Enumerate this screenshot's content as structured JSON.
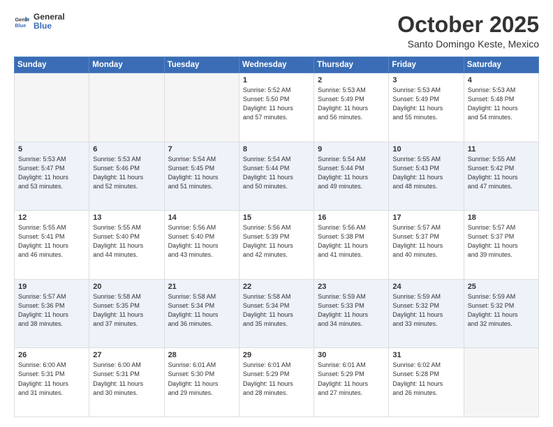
{
  "logo": {
    "text_general": "General",
    "text_blue": "Blue"
  },
  "title": "October 2025",
  "location": "Santo Domingo Keste, Mexico",
  "days_of_week": [
    "Sunday",
    "Monday",
    "Tuesday",
    "Wednesday",
    "Thursday",
    "Friday",
    "Saturday"
  ],
  "weeks": [
    {
      "row_class": "week-row-1",
      "days": [
        {
          "num": "",
          "info": "",
          "empty": true
        },
        {
          "num": "",
          "info": "",
          "empty": true
        },
        {
          "num": "",
          "info": "",
          "empty": true
        },
        {
          "num": "1",
          "info": "Sunrise: 5:52 AM\nSunset: 5:50 PM\nDaylight: 11 hours\nand 57 minutes.",
          "empty": false
        },
        {
          "num": "2",
          "info": "Sunrise: 5:53 AM\nSunset: 5:49 PM\nDaylight: 11 hours\nand 56 minutes.",
          "empty": false
        },
        {
          "num": "3",
          "info": "Sunrise: 5:53 AM\nSunset: 5:49 PM\nDaylight: 11 hours\nand 55 minutes.",
          "empty": false
        },
        {
          "num": "4",
          "info": "Sunrise: 5:53 AM\nSunset: 5:48 PM\nDaylight: 11 hours\nand 54 minutes.",
          "empty": false
        }
      ]
    },
    {
      "row_class": "week-row-2",
      "days": [
        {
          "num": "5",
          "info": "Sunrise: 5:53 AM\nSunset: 5:47 PM\nDaylight: 11 hours\nand 53 minutes.",
          "empty": false
        },
        {
          "num": "6",
          "info": "Sunrise: 5:53 AM\nSunset: 5:46 PM\nDaylight: 11 hours\nand 52 minutes.",
          "empty": false
        },
        {
          "num": "7",
          "info": "Sunrise: 5:54 AM\nSunset: 5:45 PM\nDaylight: 11 hours\nand 51 minutes.",
          "empty": false
        },
        {
          "num": "8",
          "info": "Sunrise: 5:54 AM\nSunset: 5:44 PM\nDaylight: 11 hours\nand 50 minutes.",
          "empty": false
        },
        {
          "num": "9",
          "info": "Sunrise: 5:54 AM\nSunset: 5:44 PM\nDaylight: 11 hours\nand 49 minutes.",
          "empty": false
        },
        {
          "num": "10",
          "info": "Sunrise: 5:55 AM\nSunset: 5:43 PM\nDaylight: 11 hours\nand 48 minutes.",
          "empty": false
        },
        {
          "num": "11",
          "info": "Sunrise: 5:55 AM\nSunset: 5:42 PM\nDaylight: 11 hours\nand 47 minutes.",
          "empty": false
        }
      ]
    },
    {
      "row_class": "week-row-3",
      "days": [
        {
          "num": "12",
          "info": "Sunrise: 5:55 AM\nSunset: 5:41 PM\nDaylight: 11 hours\nand 46 minutes.",
          "empty": false
        },
        {
          "num": "13",
          "info": "Sunrise: 5:55 AM\nSunset: 5:40 PM\nDaylight: 11 hours\nand 44 minutes.",
          "empty": false
        },
        {
          "num": "14",
          "info": "Sunrise: 5:56 AM\nSunset: 5:40 PM\nDaylight: 11 hours\nand 43 minutes.",
          "empty": false
        },
        {
          "num": "15",
          "info": "Sunrise: 5:56 AM\nSunset: 5:39 PM\nDaylight: 11 hours\nand 42 minutes.",
          "empty": false
        },
        {
          "num": "16",
          "info": "Sunrise: 5:56 AM\nSunset: 5:38 PM\nDaylight: 11 hours\nand 41 minutes.",
          "empty": false
        },
        {
          "num": "17",
          "info": "Sunrise: 5:57 AM\nSunset: 5:37 PM\nDaylight: 11 hours\nand 40 minutes.",
          "empty": false
        },
        {
          "num": "18",
          "info": "Sunrise: 5:57 AM\nSunset: 5:37 PM\nDaylight: 11 hours\nand 39 minutes.",
          "empty": false
        }
      ]
    },
    {
      "row_class": "week-row-4",
      "days": [
        {
          "num": "19",
          "info": "Sunrise: 5:57 AM\nSunset: 5:36 PM\nDaylight: 11 hours\nand 38 minutes.",
          "empty": false
        },
        {
          "num": "20",
          "info": "Sunrise: 5:58 AM\nSunset: 5:35 PM\nDaylight: 11 hours\nand 37 minutes.",
          "empty": false
        },
        {
          "num": "21",
          "info": "Sunrise: 5:58 AM\nSunset: 5:34 PM\nDaylight: 11 hours\nand 36 minutes.",
          "empty": false
        },
        {
          "num": "22",
          "info": "Sunrise: 5:58 AM\nSunset: 5:34 PM\nDaylight: 11 hours\nand 35 minutes.",
          "empty": false
        },
        {
          "num": "23",
          "info": "Sunrise: 5:59 AM\nSunset: 5:33 PM\nDaylight: 11 hours\nand 34 minutes.",
          "empty": false
        },
        {
          "num": "24",
          "info": "Sunrise: 5:59 AM\nSunset: 5:32 PM\nDaylight: 11 hours\nand 33 minutes.",
          "empty": false
        },
        {
          "num": "25",
          "info": "Sunrise: 5:59 AM\nSunset: 5:32 PM\nDaylight: 11 hours\nand 32 minutes.",
          "empty": false
        }
      ]
    },
    {
      "row_class": "week-row-5",
      "days": [
        {
          "num": "26",
          "info": "Sunrise: 6:00 AM\nSunset: 5:31 PM\nDaylight: 11 hours\nand 31 minutes.",
          "empty": false
        },
        {
          "num": "27",
          "info": "Sunrise: 6:00 AM\nSunset: 5:31 PM\nDaylight: 11 hours\nand 30 minutes.",
          "empty": false
        },
        {
          "num": "28",
          "info": "Sunrise: 6:01 AM\nSunset: 5:30 PM\nDaylight: 11 hours\nand 29 minutes.",
          "empty": false
        },
        {
          "num": "29",
          "info": "Sunrise: 6:01 AM\nSunset: 5:29 PM\nDaylight: 11 hours\nand 28 minutes.",
          "empty": false
        },
        {
          "num": "30",
          "info": "Sunrise: 6:01 AM\nSunset: 5:29 PM\nDaylight: 11 hours\nand 27 minutes.",
          "empty": false
        },
        {
          "num": "31",
          "info": "Sunrise: 6:02 AM\nSunset: 5:28 PM\nDaylight: 11 hours\nand 26 minutes.",
          "empty": false
        },
        {
          "num": "",
          "info": "",
          "empty": true
        }
      ]
    }
  ]
}
